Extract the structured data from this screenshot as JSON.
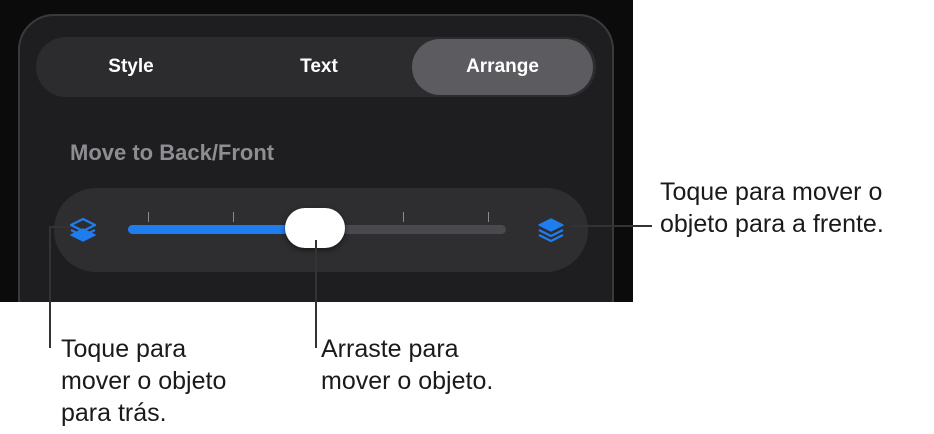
{
  "tabs": [
    {
      "label": "Style",
      "selected": false
    },
    {
      "label": "Text",
      "selected": false
    },
    {
      "label": "Arrange",
      "selected": true
    }
  ],
  "section": {
    "title": "Move to Back/Front"
  },
  "slider": {
    "value_fraction": 0.495,
    "tick_count": 4,
    "accent_color": "#1e7ef0",
    "left_icon": "layers-back-icon",
    "right_icon": "layers-front-icon"
  },
  "callouts": {
    "back": {
      "line1": "Toque para",
      "line2": "mover o objeto",
      "line3": "para trás."
    },
    "drag": {
      "line1": "Arraste para",
      "line2": "mover o objeto."
    },
    "front": {
      "line1": "Toque para mover o",
      "line2": "objeto para a frente."
    }
  }
}
